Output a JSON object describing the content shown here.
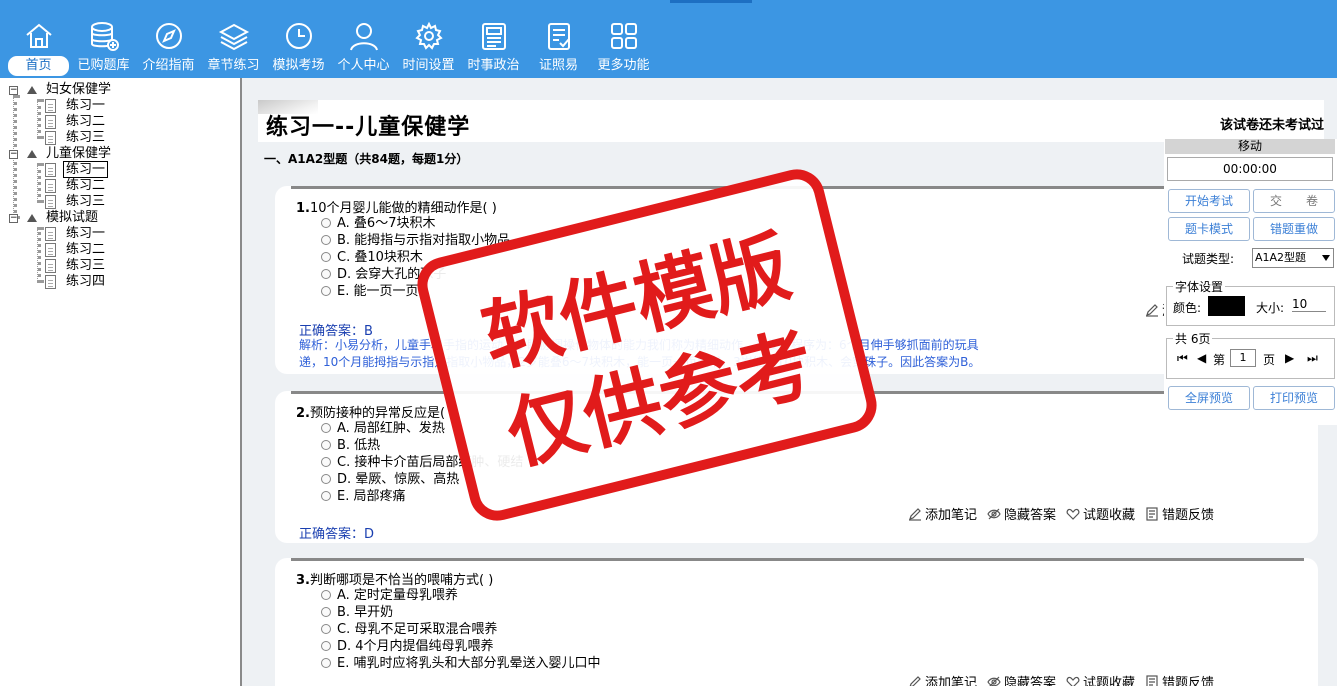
{
  "nav": {
    "items": [
      {
        "label": "首页",
        "icon": "home-icon",
        "active": true
      },
      {
        "label": "已购题库",
        "icon": "database-icon"
      },
      {
        "label": "介绍指南",
        "icon": "compass-icon"
      },
      {
        "label": "章节练习",
        "icon": "layers-icon"
      },
      {
        "label": "模拟考场",
        "icon": "clock-icon"
      },
      {
        "label": "个人中心",
        "icon": "user-icon"
      },
      {
        "label": "时间设置",
        "icon": "gear-icon"
      },
      {
        "label": "时事政治",
        "icon": "news-icon"
      },
      {
        "label": "证照易",
        "icon": "clipboard-icon"
      },
      {
        "label": "更多功能",
        "icon": "grid-icon"
      }
    ]
  },
  "tree": {
    "groups": [
      {
        "label": "妇女保健学",
        "children": [
          "练习一",
          "练习二",
          "练习三"
        ]
      },
      {
        "label": "儿童保健学",
        "children": [
          "练习一",
          "练习二",
          "练习三"
        ]
      },
      {
        "label": "模拟试题",
        "children": [
          "练习一",
          "练习二",
          "练习三",
          "练习四"
        ]
      }
    ]
  },
  "main": {
    "title": "练习一--儿童保健学",
    "status": "该试卷还未考试过",
    "section": "一、A1A2型题（共84题，每题1分）"
  },
  "actions": {
    "note": "添加笔记",
    "hide": "隐藏答案",
    "fav": "试题收藏",
    "report": "错题反馈"
  },
  "questions": [
    {
      "num": "1.",
      "text": "10个月婴儿能做的精细动作是( )",
      "options": [
        "A. 叠6～7块积木",
        "B. 能拇指与示指对指取小物品",
        "C. 叠10块积木",
        "D. 会穿大孔的珠子",
        "E. 能一页一页"
      ],
      "answer": "正确答案：B",
      "analysis1": "解析：小易分析，儿童手和手指的运动、手眼协调操作物体的能力我们称为精细动作。其发育程序为：6个月伸手够抓面前的玩具",
      "analysis2": "递，10个月能拇指与示指对指取小物品，2岁能叠6～7块积木，能一页一页翻书，3岁能叠10块积木、会穿珠子。因此答案为B。"
    },
    {
      "num": "2.",
      "text": "预防接种的异常反应是( )",
      "options": [
        "A. 局部红肿、发热",
        "B. 低热",
        "C. 接种卡介苗后局部红肿、硬结",
        "D. 晕厥、惊厥、高热",
        "E. 局部疼痛"
      ],
      "answer": "正确答案：D"
    },
    {
      "num": "3.",
      "text": "判断哪项是不恰当的喂哺方式( )",
      "options": [
        "A. 定时定量母乳喂养",
        "B. 早开奶",
        "C. 母乳不足可采取混合喂养",
        "D. 4个月内提倡纯母乳喂养",
        "E. 哺乳时应将乳头和大部分乳晕送入婴儿口中"
      ]
    }
  ],
  "panel": {
    "move": "移动",
    "timer": "00:00:00",
    "start": "开始考试",
    "submit": "交　　卷",
    "card_mode": "题卡模式",
    "redo": "错题重做",
    "type_label": "试题类型:",
    "type_value": "A1A2型题",
    "font_group": "字体设置",
    "color_label": "颜色:",
    "size_label": "大小:",
    "size_value": "10",
    "pages": "共 6页",
    "page_prefix": "第",
    "page_value": "1",
    "page_suffix": "页",
    "fullscreen": "全屏预览",
    "print": "打印预览",
    "font_color": "#000000"
  },
  "watermark": {
    "line1": "软件模版",
    "line2": "仅供参考",
    "color": "#e11b1b"
  }
}
